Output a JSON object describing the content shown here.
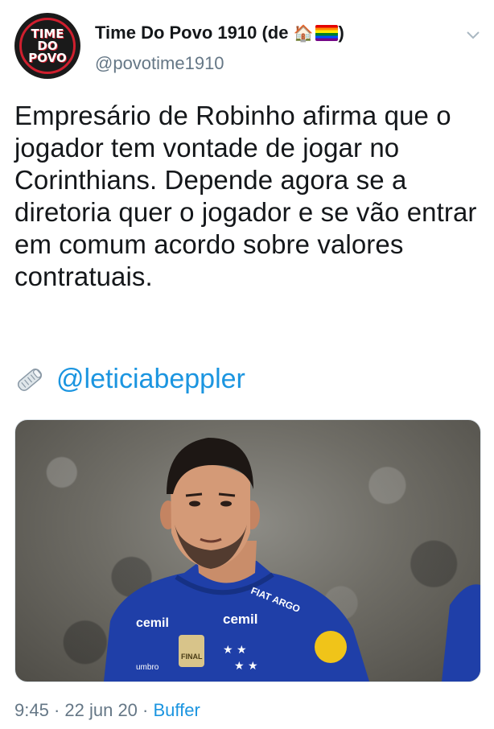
{
  "header": {
    "avatar_text": "TIME\nDO\nPOVO",
    "display_name": "Time Do Povo 1910 (de ",
    "display_name_suffix": ")",
    "house_emoji": "🏠",
    "handle": "@povotime1910",
    "menu_icon": "chevron-down-icon"
  },
  "tweet": {
    "text": "Empresário de Robinho afirma que o jogador tem vontade de jogar no Corinthians. Depende agora se a diretoria quer o jogador e se vão entrar em comum acordo sobre valores contratuais.",
    "credit_icon": "rolled-newspaper-icon",
    "mention": "@leticiabeppler"
  },
  "media": {
    "type": "photo",
    "jersey_sponsor_left": "cemil",
    "jersey_sponsor_right": "cemil",
    "jersey_brand": "FIAT ARGO",
    "jersey_badge": "FINAL",
    "kit_maker": "umbro",
    "colors": {
      "jersey": "#1f3fa8",
      "background": "#6f6d66"
    }
  },
  "footer": {
    "time": "9:45",
    "separator": " · ",
    "date": "22 jun 20",
    "source": "Buffer"
  },
  "colors": {
    "text": "#14171a",
    "secondary": "#657786",
    "link": "#1b95e0"
  }
}
